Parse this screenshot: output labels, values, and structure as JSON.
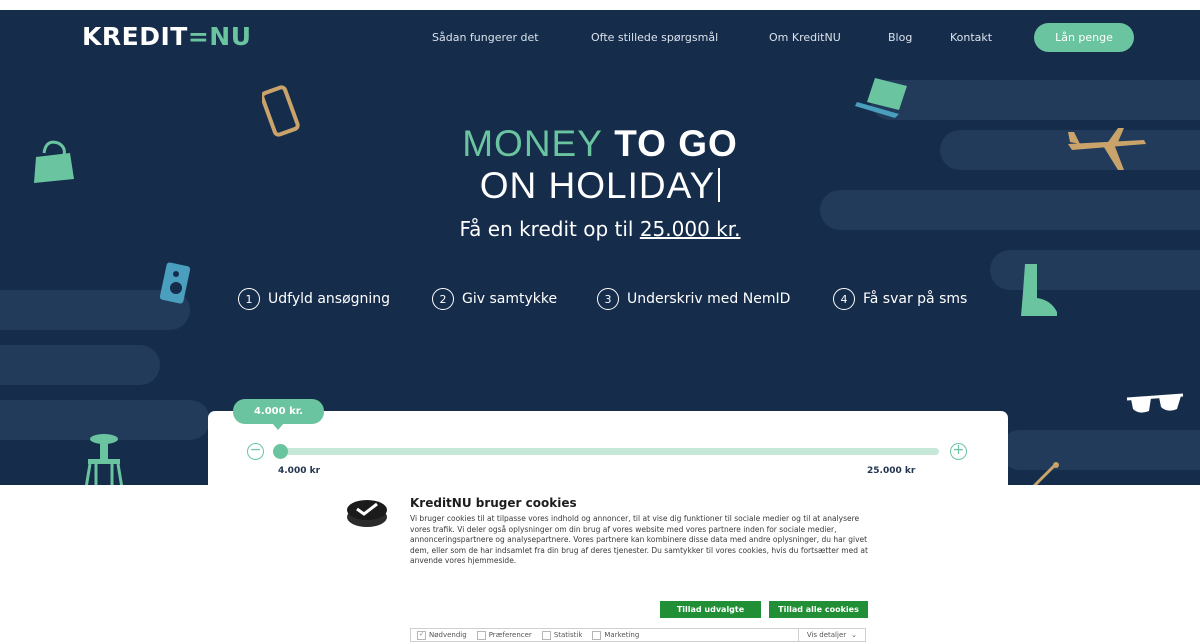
{
  "header": {
    "logo": {
      "left": "KREDIT",
      "bars": "=",
      "right": "NU"
    },
    "nav": [
      "Sådan fungerer det",
      "Ofte stillede spørgsmål",
      "Om KreditNU",
      "Blog",
      "Kontakt"
    ],
    "cta": "Lån penge"
  },
  "hero": {
    "headline_accent": "MONEY",
    "headline_main": "TO GO",
    "headline_line2": "ON HOLIDAY",
    "sub_text": "Få en kredit op til",
    "sub_amount": "25.000 kr.",
    "steps": [
      {
        "num": "1",
        "label": "Udfyld ansøgning"
      },
      {
        "num": "2",
        "label": "Giv samtykke"
      },
      {
        "num": "3",
        "label": "Underskriv med NemID"
      },
      {
        "num": "4",
        "label": "Få svar på sms"
      }
    ]
  },
  "calculator": {
    "selected_amount": "4.000 kr.",
    "slider_level": 0,
    "min_label": "4.000 kr",
    "max_label": "25.000 kr",
    "minus": "−",
    "plus": "+"
  },
  "cookie": {
    "title": "KreditNU bruger cookies",
    "body": "Vi bruger cookies til at tilpasse vores indhold og annoncer, til at vise dig funktioner til sociale medier og til at analysere vores trafik. Vi deler også oplysninger om din brug af vores website med vores partnere inden for sociale medier, annonceringspartnere og analysepartnere. Vores partnere kan kombinere disse data med andre oplysninger, du har givet dem, eller som de har indsamlet fra din brug af deres tjenester. Du samtykker til vores cookies, hvis du fortsætter med at anvende vores hjemmeside.",
    "allow_selected": "Tillad udvalgte",
    "allow_all": "Tillad alle cookies",
    "options": [
      {
        "label": "Nødvendig",
        "checked": true
      },
      {
        "label": "Præferencer",
        "checked": false
      },
      {
        "label": "Statistik",
        "checked": false
      },
      {
        "label": "Marketing",
        "checked": false
      }
    ],
    "details": "Vis detaljer"
  },
  "colors": {
    "navy": "#152c4b",
    "mint": "#6ac49f",
    "tan": "#c9a36a",
    "cookie_green": "#208f35"
  }
}
